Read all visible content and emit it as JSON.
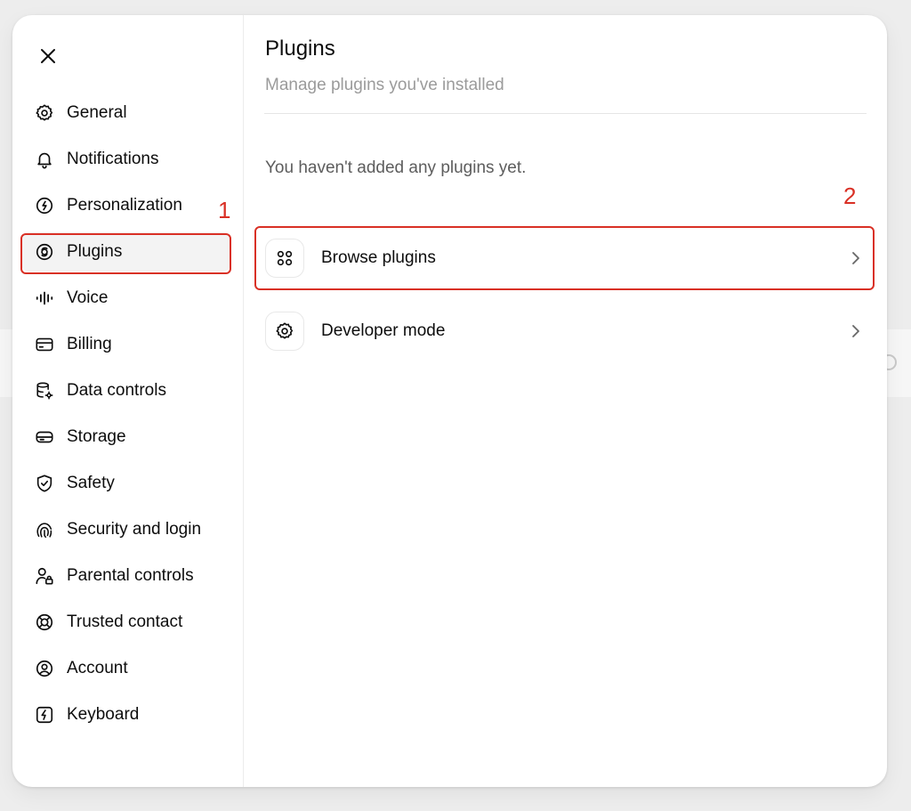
{
  "sidebar": {
    "close_label": "Close",
    "items": [
      {
        "label": "General",
        "icon": "gear-icon"
      },
      {
        "label": "Notifications",
        "icon": "bell-icon"
      },
      {
        "label": "Personalization",
        "icon": "personalization-icon"
      },
      {
        "label": "Plugins",
        "icon": "plugins-icon",
        "active": true
      },
      {
        "label": "Voice",
        "icon": "voice-waveform-icon"
      },
      {
        "label": "Billing",
        "icon": "credit-card-icon"
      },
      {
        "label": "Data controls",
        "icon": "database-gear-icon"
      },
      {
        "label": "Storage",
        "icon": "storage-drive-icon"
      },
      {
        "label": "Safety",
        "icon": "shield-check-icon"
      },
      {
        "label": "Security and login",
        "icon": "fingerprint-icon"
      },
      {
        "label": "Parental controls",
        "icon": "user-lock-icon"
      },
      {
        "label": "Trusted contact",
        "icon": "lifebuoy-icon"
      },
      {
        "label": "Account",
        "icon": "user-circle-icon"
      },
      {
        "label": "Keyboard",
        "icon": "lightning-key-icon"
      }
    ]
  },
  "main": {
    "title": "Plugins",
    "subtitle": "Manage plugins you've installed",
    "empty_text": "You haven't added any plugins yet.",
    "rows": [
      {
        "label": "Browse plugins",
        "icon": "grid-dots-icon"
      },
      {
        "label": "Developer mode",
        "icon": "gear-icon"
      }
    ]
  },
  "annotations": [
    {
      "number": "1",
      "color": "#d93025"
    },
    {
      "number": "2",
      "color": "#d93025"
    }
  ],
  "colors": {
    "accent_annotation": "#d93025",
    "active_bg": "#f3f3f3",
    "muted_text": "#9b9b9b"
  }
}
